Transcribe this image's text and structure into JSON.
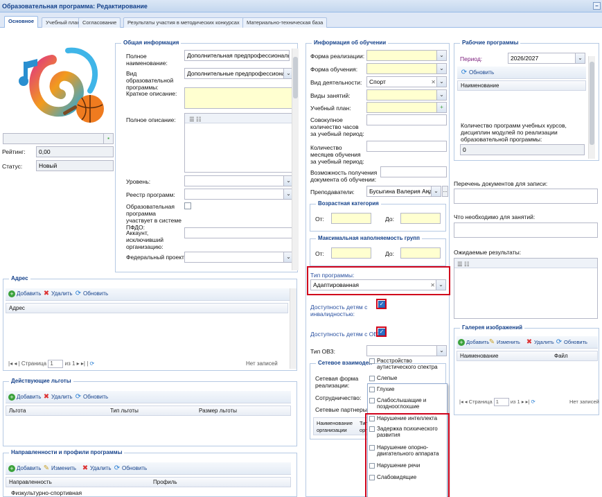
{
  "window": {
    "title": "Образовательная программа: Редактирование"
  },
  "tabs": [
    "Основное",
    "Учебный план",
    "Согласование",
    "Результаты участия в методических конкурсах",
    "Материально-техническая база"
  ],
  "general": {
    "legend": "Общая информация",
    "full_name_label": "Полное наименование:",
    "full_name_value": "Дополнительная предпрофессиональная п",
    "kind_label": "Вид образовательной программы:",
    "kind_value": "Дополнительные предпрофессиональн",
    "short_desc_label": "Краткое описание:",
    "full_desc_label": "Полное описание:",
    "level_label": "Уровень:",
    "registry_label": "Реестр программ:",
    "pfdo_label": "Образовательная программа участвует в системе ПФДО:",
    "account_label": "Аккаунт, исключивший организацию:",
    "federal_label": "Федеральный проект:",
    "rating_label": "Рейтинг:",
    "rating_value": "0,00",
    "status_label": "Статус:",
    "status_value": "Новый"
  },
  "training": {
    "legend": "Информация об обучении",
    "form_impl_label": "Форма реализации:",
    "form_edu_label": "Форма обучения:",
    "activity_label": "Вид деятельности:",
    "activity_value": "Спорт",
    "lesson_types_label": "Виды занятий:",
    "plan_label": "Учебный план:",
    "hours_label": "Совокупное количество часов за учебный период:",
    "months_label": "Количество месяцев обучения за учебный период:",
    "doc_label": "Возможность получения документа об обучении:",
    "teachers_label": "Преподаватели:",
    "teachers_value": "Бусыгина Валерия Анд",
    "age_legend": "Возрастная категория",
    "from_label": "От:",
    "to_label": "До:",
    "group_legend": "Максимальная наполняемость групп",
    "prog_type_label": "Тип программы:",
    "prog_type_value": "Адаптированная",
    "disabled_label": "Доступность детям с инвалидностью:",
    "ovz_label": "Доступность детям с ОВЗ:",
    "ovz_type_label": "Тип ОВЗ:",
    "network_legend": "Сетевое взаимодей",
    "network_form_label": "Сетевая форма реализации:",
    "cooperation_label": "Сотрудничество:",
    "partners_label": "Сетевые партнеры:",
    "partners_col1": "Наименование организации",
    "partners_col2": "Тип орг"
  },
  "ovz_options": [
    "Расстройство аутистического спектра",
    "Слепые",
    "Глухие",
    "Слабослышащие и позднооглохшие",
    "Нарушение интеллекта",
    "Задержка психического развития",
    "Нарушение опорно-двигательного аппарата",
    "Нарушение речи",
    "Слабовидящие"
  ],
  "work_programs": {
    "legend": "Рабочие программы",
    "period_label": "Период:",
    "period_value": "2026/2027",
    "refresh": "Обновить",
    "col_name": "Наименование",
    "count_label": "Количество программ учебных курсов, дисциплин модулей по реализации образовательной программы:",
    "count_value": "0"
  },
  "right": {
    "docs_label": "Перечень документов для записи:",
    "needed_label": "Что необходимо для занятий:",
    "results_label": "Ожидаемые результаты:"
  },
  "gallery": {
    "legend": "Галерея изображений",
    "add": "Добавить",
    "edit": "Изменить",
    "delete": "Удалить",
    "refresh": "Обновить",
    "col_name": "Наименование",
    "col_file": "Файл",
    "page_label": "Страница",
    "page_value": "1",
    "of_label": "из 1",
    "no_records": "Нет записей"
  },
  "address": {
    "legend": "Адрес",
    "add": "Добавить",
    "delete": "Удалить",
    "refresh": "Обновить",
    "col": "Адрес",
    "page_label": "Страница",
    "page_value": "1",
    "of_label": "из 1",
    "no_records": "Нет записей"
  },
  "benefits": {
    "legend": "Действующие льготы",
    "add": "Добавить",
    "delete": "Удалить",
    "refresh": "Обновить",
    "col1": "Льгота",
    "col2": "Тип льготы",
    "col3": "Размер льготы"
  },
  "directions": {
    "legend": "Направленности и профили программы",
    "add": "Добавить",
    "edit": "Изменить",
    "delete": "Удалить",
    "refresh": "Обновить",
    "col1": "Направленность",
    "col2": "Профиль",
    "row1": "Физкультурно-спортивная"
  }
}
